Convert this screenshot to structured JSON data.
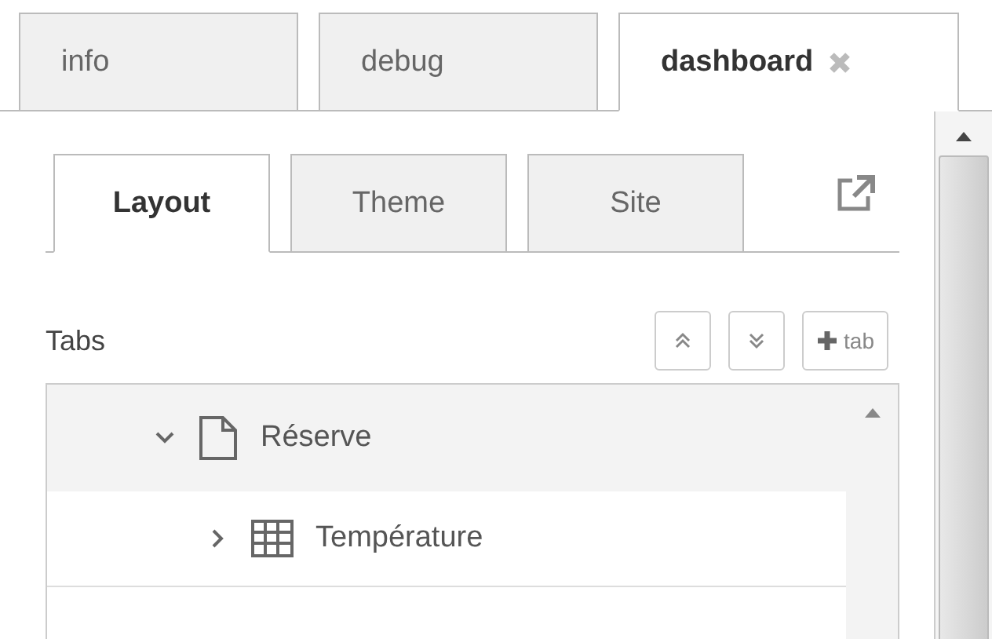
{
  "sidebar_tabs": [
    {
      "label": "info",
      "selected": false,
      "closable": false
    },
    {
      "label": "debug",
      "selected": false,
      "closable": false
    },
    {
      "label": "dashboard",
      "selected": true,
      "closable": true
    }
  ],
  "dashboard": {
    "tabs": [
      {
        "label": "Layout",
        "selected": true
      },
      {
        "label": "Theme",
        "selected": false
      },
      {
        "label": "Site",
        "selected": false
      }
    ],
    "tabs_section": {
      "label": "Tabs",
      "buttons": [
        {
          "kind": "collapse"
        },
        {
          "kind": "expand"
        },
        {
          "kind": "add",
          "label": "tab"
        }
      ]
    },
    "tree": [
      {
        "kind": "tab",
        "label": "Réserve",
        "expanded": true,
        "selected": true,
        "children": [
          {
            "kind": "group",
            "label": "Température",
            "expanded": false,
            "selected": false
          }
        ]
      }
    ]
  }
}
